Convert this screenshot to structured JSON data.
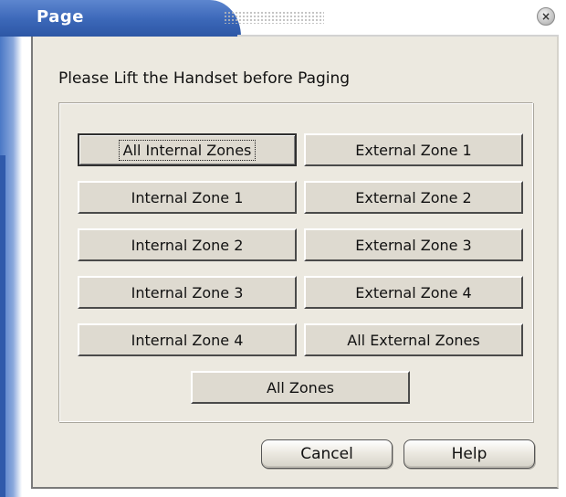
{
  "window": {
    "title": "Page",
    "close_icon": "close-icon"
  },
  "dialog": {
    "instruction": "Please Lift the Handset before Paging",
    "zones": {
      "all_internal": "All Internal Zones",
      "external_1": "External Zone 1",
      "internal_1": "Internal Zone 1",
      "external_2": "External Zone 2",
      "internal_2": "Internal Zone 2",
      "external_3": "External Zone 3",
      "internal_3": "Internal Zone 3",
      "external_4": "External Zone 4",
      "internal_4": "Internal Zone 4",
      "all_external": "All External Zones",
      "all_zones": "All Zones"
    },
    "focused_button": "all_internal",
    "buttons": {
      "cancel": "Cancel",
      "help": "Help"
    }
  },
  "colors": {
    "title_bar": "#3b67b8",
    "dialog_bg": "#ece9e0",
    "button_face": "#dedad0"
  }
}
